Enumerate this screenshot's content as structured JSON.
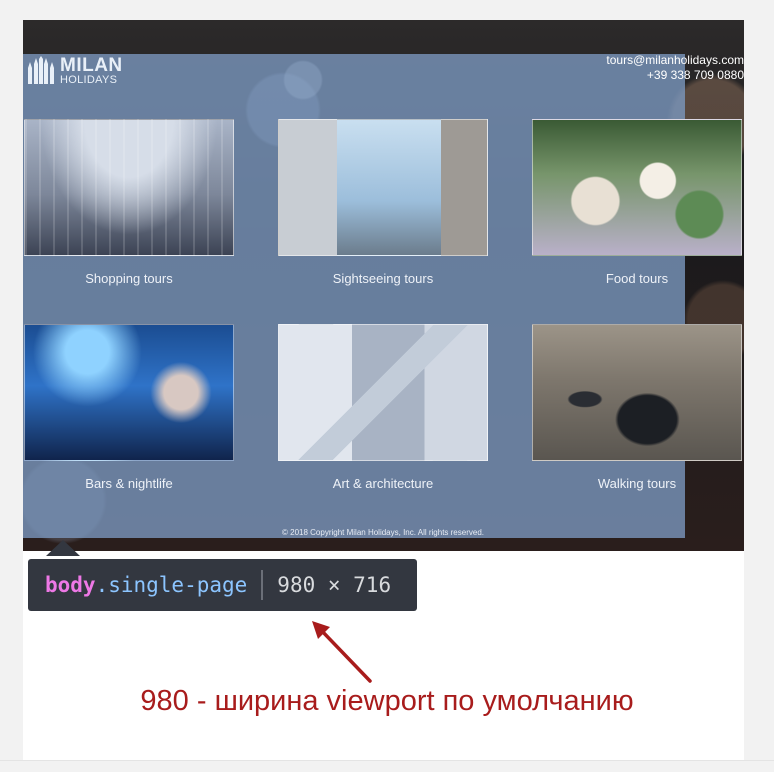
{
  "site": {
    "logo": {
      "line1": "MILAN",
      "line2": "HOLIDAYS"
    },
    "contact": {
      "email": "tours@milanholidays.com",
      "phone": "+39 338 709 0880"
    },
    "tours": [
      {
        "label": "Shopping tours",
        "image": "galleria-photo"
      },
      {
        "label": "Sightseeing tours",
        "image": "street-towers-photo"
      },
      {
        "label": "Food tours",
        "image": "cafe-table-photo"
      },
      {
        "label": "Bars & nightlife",
        "image": "dj-party-photo"
      },
      {
        "label": "Art & architecture",
        "image": "modern-building-photo"
      },
      {
        "label": "Walking tours",
        "image": "street-vintage-car-photo"
      }
    ],
    "copyright": "© 2018 Copyright Milan Holidays, Inc. All rights reserved."
  },
  "devtools_tooltip": {
    "tag": "body",
    "class": ".single-page",
    "dimensions": "980 × 716"
  },
  "caption": "980 - ширина viewport по умолчанию",
  "colors": {
    "overlay": "#7c9ac2",
    "tooltip_bg": "#333740",
    "tag": "#ee78e6",
    "class": "#8cc5ff",
    "caption": "#a81c1c"
  }
}
